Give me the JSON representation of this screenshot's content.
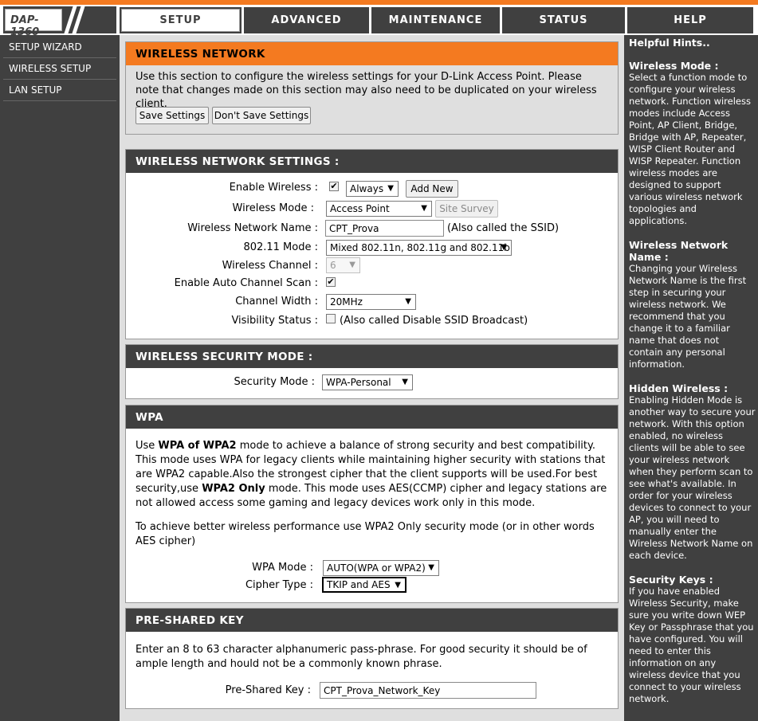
{
  "logo": {
    "text": "DAP-1360"
  },
  "tabs": [
    {
      "label": "SETUP",
      "active": true
    },
    {
      "label": "ADVANCED",
      "active": false
    },
    {
      "label": "MAINTENANCE",
      "active": false
    },
    {
      "label": "STATUS",
      "active": false
    },
    {
      "label": "HELP",
      "active": false
    }
  ],
  "sidebar": {
    "items": [
      {
        "label": "SETUP WIZARD"
      },
      {
        "label": "WIRELESS SETUP"
      },
      {
        "label": "LAN SETUP"
      }
    ]
  },
  "intro": {
    "title": "WIRELESS NETWORK",
    "text": "Use this section to configure the wireless settings for your D-Link Access Point. Please note that changes made on this section may also need to be duplicated on your wireless client.",
    "save_label": "Save Settings",
    "dont_save_label": "Don't Save Settings"
  },
  "settings": {
    "title": "WIRELESS NETWORK SETTINGS :",
    "enable_wireless_label": "Enable Wireless :",
    "enable_wireless_checked": true,
    "schedule_value": "Always",
    "add_new_label": "Add New",
    "wireless_mode_label": "Wireless Mode :",
    "wireless_mode_value": "Access Point",
    "site_survey_label": "Site Survey",
    "network_name_label": "Wireless Network Name :",
    "network_name_value": "CPT_Prova",
    "network_name_note": "(Also called the SSID)",
    "mode_80211_label": "802.11 Mode :",
    "mode_80211_value": "Mixed 802.11n, 802.11g and 802.11b",
    "channel_label": "Wireless Channel :",
    "channel_value": "6",
    "auto_scan_label": "Enable Auto Channel Scan :",
    "auto_scan_checked": true,
    "channel_width_label": "Channel Width :",
    "channel_width_value": "20MHz",
    "visibility_label": "Visibility Status :",
    "visibility_checked": false,
    "visibility_note": "(Also called Disable SSID Broadcast)"
  },
  "security": {
    "title": "WIRELESS SECURITY MODE :",
    "mode_label": "Security Mode :",
    "mode_value": "WPA-Personal"
  },
  "wpa": {
    "title": "WPA",
    "p1_a": "Use ",
    "p1_b": "WPA of WPA2",
    "p1_c": " mode to achieve a balance of strong security and best compatibility. This mode uses WPA for legacy clients while maintaining higher security with stations that are WPA2 capable.Also the strongest cipher that the client supports will be used.For best security,use ",
    "p1_d": "WPA2 Only",
    "p1_e": " mode. This mode uses AES(CCMP) cipher and legacy stations are not allowed access some gaming and legacy devices work only in this mode.",
    "p2": "To achieve better wireless performance use WPA2 Only security mode (or in other words AES cipher)",
    "wpa_mode_label": "WPA Mode :",
    "wpa_mode_value": "AUTO(WPA or WPA2)",
    "cipher_label": "Cipher Type :",
    "cipher_value": "TKIP and AES"
  },
  "psk": {
    "title": "PRE-SHARED KEY",
    "text": "Enter an 8 to 63 character alphanumeric pass-phrase. For good security it should be of ample length and hould not be a commonly known phrase.",
    "key_label": "Pre-Shared Key :",
    "key_value": "CPT_Prova_Network_Key"
  },
  "hints": {
    "title": "Helpful Hints..",
    "sections": [
      {
        "heading": "Wireless Mode :",
        "body": "Select a function mode to configure your wireless network. Function wireless modes include Access Point, AP Client, Bridge, Bridge with AP, Repeater, WISP Client Router and WISP Repeater. Function wireless modes are designed to support various wireless network topologies and applications."
      },
      {
        "heading": "Wireless Network Name :",
        "body": "Changing your Wireless Network Name is the first step in securing your wireless network. We recommend that you change it to a familiar name that does not contain any personal information."
      },
      {
        "heading": "Hidden Wireless :",
        "body": "Enabling Hidden Mode is another way to secure your network. With this option enabled, no wireless clients will be able to see your wireless network when they perform scan to see what's available. In order for your wireless devices to connect to your AP, you will need to manually enter the Wireless Network Name on each device."
      },
      {
        "heading": "Security Keys :",
        "body": "If you have enabled Wireless Security, make sure you write down WEP Key or Passphrase that you have configured. You will need to enter this information on any wireless device that you connect to your wireless network."
      }
    ]
  },
  "colors": {
    "accent": "#f47a20",
    "dark": "#404040",
    "panel": "#dfdfdf"
  }
}
